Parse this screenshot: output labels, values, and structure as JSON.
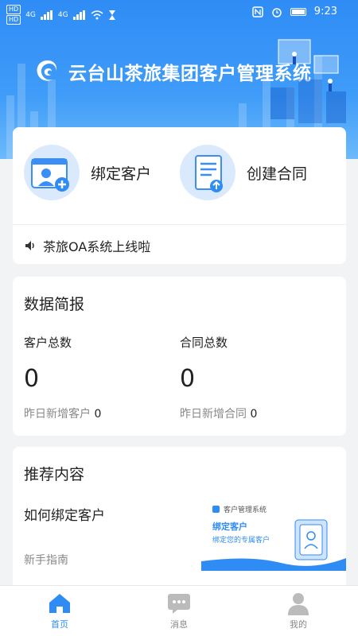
{
  "status_bar": {
    "time": "9:23",
    "net_labels": [
      "HD",
      "HD"
    ],
    "sig_labels": [
      "4G",
      "4G"
    ]
  },
  "header": {
    "title": "云台山茶旅集团客户管理系统"
  },
  "actions": [
    {
      "label": "绑定客户",
      "icon": "bind-customer-icon"
    },
    {
      "label": "创建合同",
      "icon": "create-contract-icon"
    }
  ],
  "notice": {
    "text": "茶旅OA系统上线啦",
    "icon": "speaker-icon"
  },
  "stats": {
    "title": "数据简报",
    "customers": {
      "label": "客户总数",
      "value": "0",
      "sub_label": "昨日新增客户",
      "sub_value": "0"
    },
    "contracts": {
      "label": "合同总数",
      "value": "0",
      "sub_label": "昨日新增合同",
      "sub_value": "0"
    }
  },
  "recommend": {
    "title": "推荐内容",
    "item_title": "如何绑定客户",
    "item_sub": "新手指南",
    "thumb": {
      "brand": "客户管理系统",
      "heading": "绑定客户",
      "caption": "绑定您的专属客户"
    }
  },
  "tabs": [
    {
      "label": "首页",
      "icon": "home-icon",
      "active": true
    },
    {
      "label": "消息",
      "icon": "message-icon",
      "active": false
    },
    {
      "label": "我的",
      "icon": "profile-icon",
      "active": false
    }
  ],
  "colors": {
    "primary": "#2f8cf5",
    "text": "#222222",
    "muted": "#888888"
  }
}
